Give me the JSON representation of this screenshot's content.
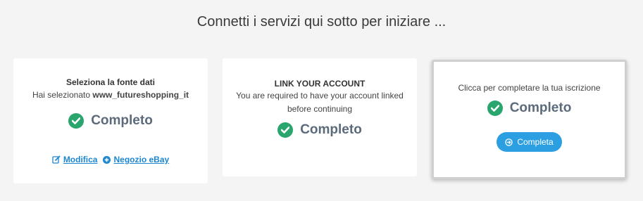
{
  "header": {
    "title": "Connetti i servizi qui sotto per iniziare ..."
  },
  "cards": [
    {
      "title": "Seleziona la fonte dati",
      "subtitle_prefix": "Hai selezionato",
      "selected_source": "www_futureshopping_it",
      "status": "Completo",
      "links": [
        {
          "label": "Modifica",
          "icon": "edit-icon"
        },
        {
          "label": "Negozio eBay",
          "icon": "plus-circle-icon"
        }
      ]
    },
    {
      "title": "LINK YOUR ACCOUNT",
      "description_line1": "You are required to have your account linked",
      "description_line2": "before continuing",
      "status": "Completo"
    },
    {
      "description": "Clicca per completare la tua iscrizione",
      "status": "Completo",
      "button": {
        "label": "Completa",
        "icon": "arrow-circle-right-icon"
      }
    }
  ],
  "colors": {
    "background": "#f4f4f4",
    "check_green": "#2aa56e",
    "link_blue": "#1d86d1",
    "button_blue": "#2b9fe2",
    "status_text": "#5b6b7b"
  }
}
